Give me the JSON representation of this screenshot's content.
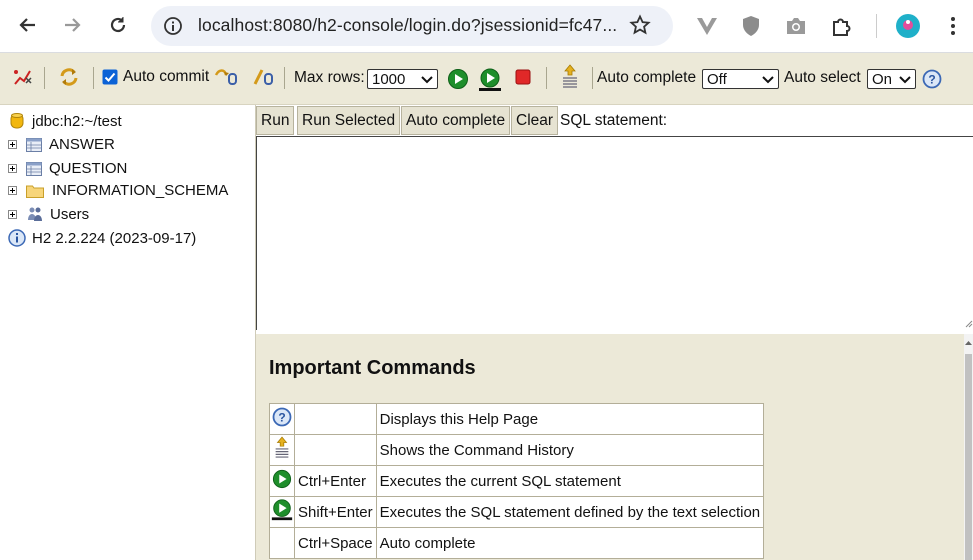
{
  "browser": {
    "url": "localhost:8080/h2-console/login.do?jsessionid=fc47...",
    "avatar_color": "#1fb0c9"
  },
  "toolbar": {
    "auto_commit_label": "Auto commit",
    "auto_commit_checked": true,
    "max_rows_label": "Max rows:",
    "max_rows_value": "1000",
    "auto_complete_label": "Auto complete",
    "auto_complete_value": "Off",
    "auto_select_label": "Auto select",
    "auto_select_value": "On"
  },
  "tree": {
    "connection": "jdbc:h2:~/test",
    "items": [
      {
        "label": "ANSWER",
        "icon": "table-icon"
      },
      {
        "label": "QUESTION",
        "icon": "table-icon"
      },
      {
        "label": "INFORMATION_SCHEMA",
        "icon": "folder-icon"
      },
      {
        "label": "Users",
        "icon": "users-icon"
      }
    ],
    "version": "H2 2.2.224 (2023-09-17)"
  },
  "query": {
    "run_label": "Run",
    "run_selected_label": "Run Selected",
    "auto_complete_label": "Auto complete",
    "clear_label": "Clear",
    "sql_label": "SQL statement:",
    "sql_text": ""
  },
  "help": {
    "title": "Important Commands",
    "rows": [
      {
        "icon": "help-icon",
        "key": "",
        "desc": "Displays this Help Page"
      },
      {
        "icon": "history-icon",
        "key": "",
        "desc": "Shows the Command History"
      },
      {
        "icon": "run-icon",
        "key": "Ctrl+Enter",
        "desc": "Executes the current SQL statement"
      },
      {
        "icon": "run-selected-icon",
        "key": "Shift+Enter",
        "desc": "Executes the SQL statement defined by the text selection"
      },
      {
        "icon": "",
        "key": "Ctrl+Space",
        "desc": "Auto complete"
      }
    ]
  }
}
